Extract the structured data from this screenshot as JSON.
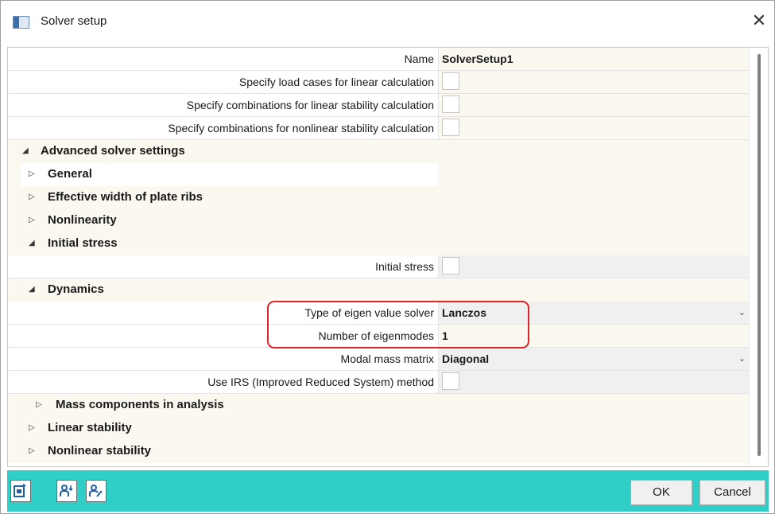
{
  "window": {
    "title": "Solver setup",
    "app_icon": "window-icon",
    "close_icon": "close-icon",
    "close_glyph": "✕"
  },
  "grid": {
    "name_label": "Name",
    "name_value": "SolverSetup1",
    "rows": {
      "load_cases": "Specify load cases for linear calculation",
      "combos_linear_stability": "Specify combinations for linear stability calculation",
      "combos_nonlinear_stability": "Specify combinations for nonlinear stability calculation"
    },
    "sections": {
      "advanced": "Advanced solver settings",
      "general": "General",
      "effective_width": "Effective width of plate ribs",
      "nonlinearity": "Nonlinearity",
      "initial_stress": "Initial stress",
      "dynamics": "Dynamics",
      "mass_components": "Mass components in analysis",
      "linear_stability": "Linear stability",
      "nonlinear_stability": "Nonlinear stability"
    },
    "initial_stress_label": "Initial stress",
    "dynamics_rows": {
      "eigen_solver_label": "Type of eigen value solver",
      "eigen_solver_value": "Lanczos",
      "eigenmodes_label": "Number of eigenmodes",
      "eigenmodes_value": "1",
      "modal_mass_label": "Modal mass matrix",
      "modal_mass_value": "Diagonal",
      "irs_label": "Use IRS (Improved Reduced System) method"
    },
    "toggles": {
      "expanded": "◢",
      "collapsed": "▷"
    },
    "dropdown_glyph": "⌄"
  },
  "footer": {
    "ok_label": "OK",
    "cancel_label": "Cancel",
    "tools": [
      "new-setup-icon",
      "users-download-icon",
      "user-edit-icon"
    ]
  },
  "colors": {
    "footer_bg": "#2fcfc7",
    "value_bg": "#fbf8ef",
    "highlight": "#e0242a"
  }
}
